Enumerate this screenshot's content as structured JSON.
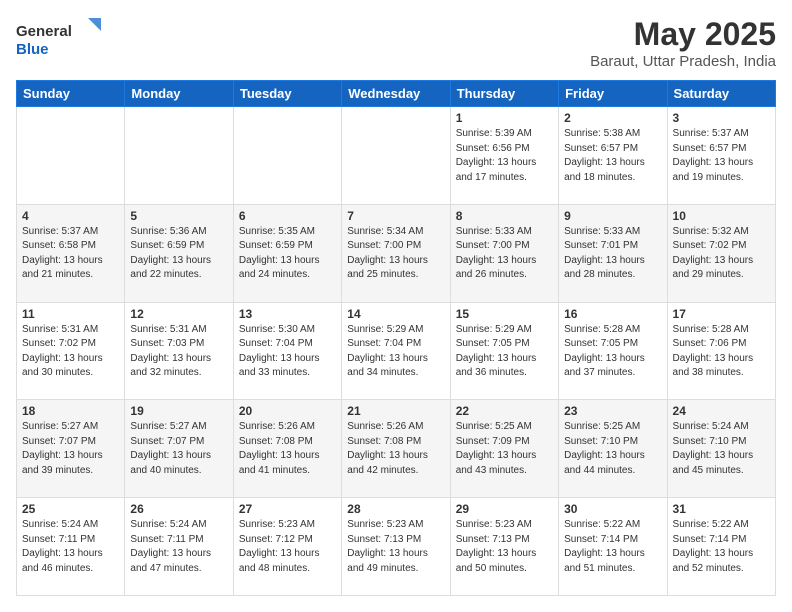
{
  "header": {
    "logo_line1": "General",
    "logo_line2": "Blue",
    "title": "May 2025",
    "subtitle": "Baraut, Uttar Pradesh, India"
  },
  "days_of_week": [
    "Sunday",
    "Monday",
    "Tuesday",
    "Wednesday",
    "Thursday",
    "Friday",
    "Saturday"
  ],
  "weeks": [
    [
      {
        "day": "",
        "info": ""
      },
      {
        "day": "",
        "info": ""
      },
      {
        "day": "",
        "info": ""
      },
      {
        "day": "",
        "info": ""
      },
      {
        "day": "1",
        "info": "Sunrise: 5:39 AM\nSunset: 6:56 PM\nDaylight: 13 hours\nand 17 minutes."
      },
      {
        "day": "2",
        "info": "Sunrise: 5:38 AM\nSunset: 6:57 PM\nDaylight: 13 hours\nand 18 minutes."
      },
      {
        "day": "3",
        "info": "Sunrise: 5:37 AM\nSunset: 6:57 PM\nDaylight: 13 hours\nand 19 minutes."
      }
    ],
    [
      {
        "day": "4",
        "info": "Sunrise: 5:37 AM\nSunset: 6:58 PM\nDaylight: 13 hours\nand 21 minutes."
      },
      {
        "day": "5",
        "info": "Sunrise: 5:36 AM\nSunset: 6:59 PM\nDaylight: 13 hours\nand 22 minutes."
      },
      {
        "day": "6",
        "info": "Sunrise: 5:35 AM\nSunset: 6:59 PM\nDaylight: 13 hours\nand 24 minutes."
      },
      {
        "day": "7",
        "info": "Sunrise: 5:34 AM\nSunset: 7:00 PM\nDaylight: 13 hours\nand 25 minutes."
      },
      {
        "day": "8",
        "info": "Sunrise: 5:33 AM\nSunset: 7:00 PM\nDaylight: 13 hours\nand 26 minutes."
      },
      {
        "day": "9",
        "info": "Sunrise: 5:33 AM\nSunset: 7:01 PM\nDaylight: 13 hours\nand 28 minutes."
      },
      {
        "day": "10",
        "info": "Sunrise: 5:32 AM\nSunset: 7:02 PM\nDaylight: 13 hours\nand 29 minutes."
      }
    ],
    [
      {
        "day": "11",
        "info": "Sunrise: 5:31 AM\nSunset: 7:02 PM\nDaylight: 13 hours\nand 30 minutes."
      },
      {
        "day": "12",
        "info": "Sunrise: 5:31 AM\nSunset: 7:03 PM\nDaylight: 13 hours\nand 32 minutes."
      },
      {
        "day": "13",
        "info": "Sunrise: 5:30 AM\nSunset: 7:04 PM\nDaylight: 13 hours\nand 33 minutes."
      },
      {
        "day": "14",
        "info": "Sunrise: 5:29 AM\nSunset: 7:04 PM\nDaylight: 13 hours\nand 34 minutes."
      },
      {
        "day": "15",
        "info": "Sunrise: 5:29 AM\nSunset: 7:05 PM\nDaylight: 13 hours\nand 36 minutes."
      },
      {
        "day": "16",
        "info": "Sunrise: 5:28 AM\nSunset: 7:05 PM\nDaylight: 13 hours\nand 37 minutes."
      },
      {
        "day": "17",
        "info": "Sunrise: 5:28 AM\nSunset: 7:06 PM\nDaylight: 13 hours\nand 38 minutes."
      }
    ],
    [
      {
        "day": "18",
        "info": "Sunrise: 5:27 AM\nSunset: 7:07 PM\nDaylight: 13 hours\nand 39 minutes."
      },
      {
        "day": "19",
        "info": "Sunrise: 5:27 AM\nSunset: 7:07 PM\nDaylight: 13 hours\nand 40 minutes."
      },
      {
        "day": "20",
        "info": "Sunrise: 5:26 AM\nSunset: 7:08 PM\nDaylight: 13 hours\nand 41 minutes."
      },
      {
        "day": "21",
        "info": "Sunrise: 5:26 AM\nSunset: 7:08 PM\nDaylight: 13 hours\nand 42 minutes."
      },
      {
        "day": "22",
        "info": "Sunrise: 5:25 AM\nSunset: 7:09 PM\nDaylight: 13 hours\nand 43 minutes."
      },
      {
        "day": "23",
        "info": "Sunrise: 5:25 AM\nSunset: 7:10 PM\nDaylight: 13 hours\nand 44 minutes."
      },
      {
        "day": "24",
        "info": "Sunrise: 5:24 AM\nSunset: 7:10 PM\nDaylight: 13 hours\nand 45 minutes."
      }
    ],
    [
      {
        "day": "25",
        "info": "Sunrise: 5:24 AM\nSunset: 7:11 PM\nDaylight: 13 hours\nand 46 minutes."
      },
      {
        "day": "26",
        "info": "Sunrise: 5:24 AM\nSunset: 7:11 PM\nDaylight: 13 hours\nand 47 minutes."
      },
      {
        "day": "27",
        "info": "Sunrise: 5:23 AM\nSunset: 7:12 PM\nDaylight: 13 hours\nand 48 minutes."
      },
      {
        "day": "28",
        "info": "Sunrise: 5:23 AM\nSunset: 7:13 PM\nDaylight: 13 hours\nand 49 minutes."
      },
      {
        "day": "29",
        "info": "Sunrise: 5:23 AM\nSunset: 7:13 PM\nDaylight: 13 hours\nand 50 minutes."
      },
      {
        "day": "30",
        "info": "Sunrise: 5:22 AM\nSunset: 7:14 PM\nDaylight: 13 hours\nand 51 minutes."
      },
      {
        "day": "31",
        "info": "Sunrise: 5:22 AM\nSunset: 7:14 PM\nDaylight: 13 hours\nand 52 minutes."
      }
    ]
  ]
}
